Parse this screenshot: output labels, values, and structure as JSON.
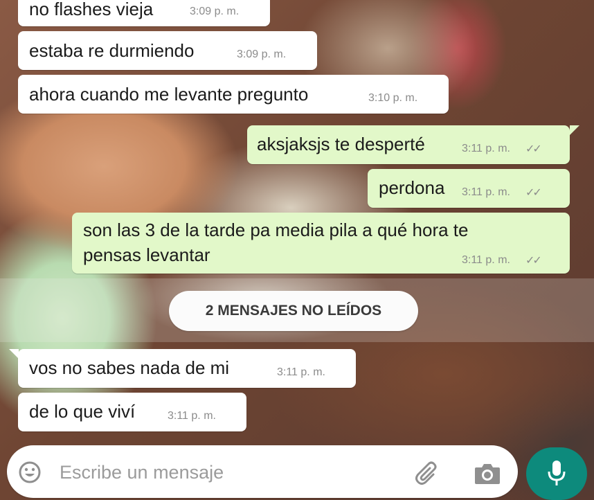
{
  "messages": [
    {
      "text": "no flashes vieja",
      "time": "3:09 p. m."
    },
    {
      "text": "estaba re durmiendo",
      "time": "3:09 p. m."
    },
    {
      "text": "ahora cuando me levante pregunto",
      "time": "3:10 p. m."
    },
    {
      "text": "aksjaksjs te desperté",
      "time": "3:11 p. m."
    },
    {
      "text": "perdona",
      "time": "3:11 p. m."
    },
    {
      "text_line1": "son las 3 de la tarde pa media pila a qué hora te",
      "text_line2": "pensas levantar",
      "time": "3:11 p. m."
    },
    {
      "text": "vos no sabes nada de mi",
      "time": "3:11 p. m."
    },
    {
      "text": "de lo que viví",
      "time": "3:11 p. m."
    }
  ],
  "unread_divider": "2 MENSAJES NO LEÍDOS",
  "composer": {
    "placeholder": "Escribe un mensaje",
    "icons": [
      "emoji-icon",
      "attach-icon",
      "camera-icon",
      "microphone-icon"
    ]
  },
  "colors": {
    "incoming": "#ffffff",
    "outgoing": "#e2f8c9",
    "read_ticks": "#8b8b8b",
    "accent": "#0d8a7c"
  }
}
